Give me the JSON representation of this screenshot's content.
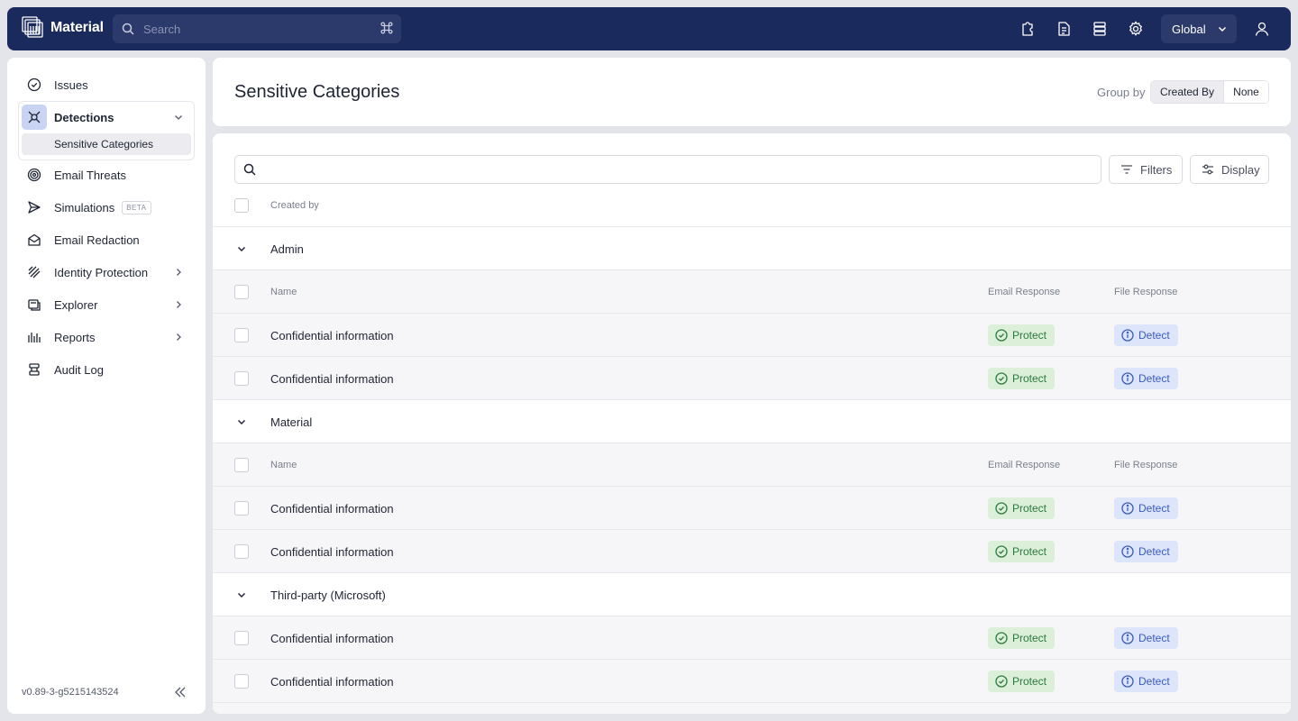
{
  "app": {
    "name": "Material"
  },
  "search": {
    "placeholder": "Search",
    "shortcut": "⌘"
  },
  "topbar": {
    "icons": [
      "puzzle-icon",
      "document-icon",
      "server-icon",
      "gear-icon",
      "user-icon"
    ],
    "scope_label": "Global"
  },
  "sidebar": {
    "items": [
      {
        "label": "Issues",
        "icon": "check-circle-icon"
      },
      {
        "label": "Detections",
        "icon": "detections-icon",
        "expanded": true
      },
      {
        "label": "Sensitive Categories",
        "selected": true
      },
      {
        "label": "Email Threats",
        "icon": "target-icon"
      },
      {
        "label": "Simulations",
        "icon": "send-icon",
        "badge": "BETA"
      },
      {
        "label": "Email Redaction",
        "icon": "envelope-icon"
      },
      {
        "label": "Identity Protection",
        "icon": "identity-icon",
        "has_children": true
      },
      {
        "label": "Explorer",
        "icon": "explorer-icon",
        "has_children": true
      },
      {
        "label": "Reports",
        "icon": "bars-icon",
        "has_children": true
      },
      {
        "label": "Audit Log",
        "icon": "log-icon"
      }
    ],
    "version": "v0.89-3-g5215143524"
  },
  "header": {
    "title": "Sensitive Categories",
    "group_by_label": "Group by",
    "group_by_options": [
      "Created By",
      "None"
    ],
    "group_by_selected": "Created By"
  },
  "table": {
    "search_placeholder": "",
    "filters_label": "Filters",
    "display_label": "Display",
    "group_header": "Created by",
    "columns": {
      "name": "Name",
      "email": "Email Response",
      "file": "File Response"
    },
    "groups": [
      {
        "name": "Admin",
        "show_columns": true,
        "rows": [
          {
            "name": "Confidential information",
            "email": "Protect",
            "file": "Detect"
          },
          {
            "name": "Confidential information",
            "email": "Protect",
            "file": "Detect"
          }
        ]
      },
      {
        "name": "Material",
        "show_columns": true,
        "rows": [
          {
            "name": "Confidential information",
            "email": "Protect",
            "file": "Detect"
          },
          {
            "name": "Confidential information",
            "email": "Protect",
            "file": "Detect"
          }
        ]
      },
      {
        "name": "Third-party (Microsoft)",
        "show_columns": false,
        "rows": [
          {
            "name": "Confidential information",
            "email": "Protect",
            "file": "Detect"
          },
          {
            "name": "Confidential information",
            "email": "Protect",
            "file": "Detect"
          }
        ]
      }
    ]
  },
  "colors": {
    "topbar": "#1b2a5c",
    "protect_bg": "#dcefd9",
    "protect_fg": "#2b7a3b",
    "detect_bg": "#dde5fa",
    "detect_fg": "#3b5bc4"
  }
}
